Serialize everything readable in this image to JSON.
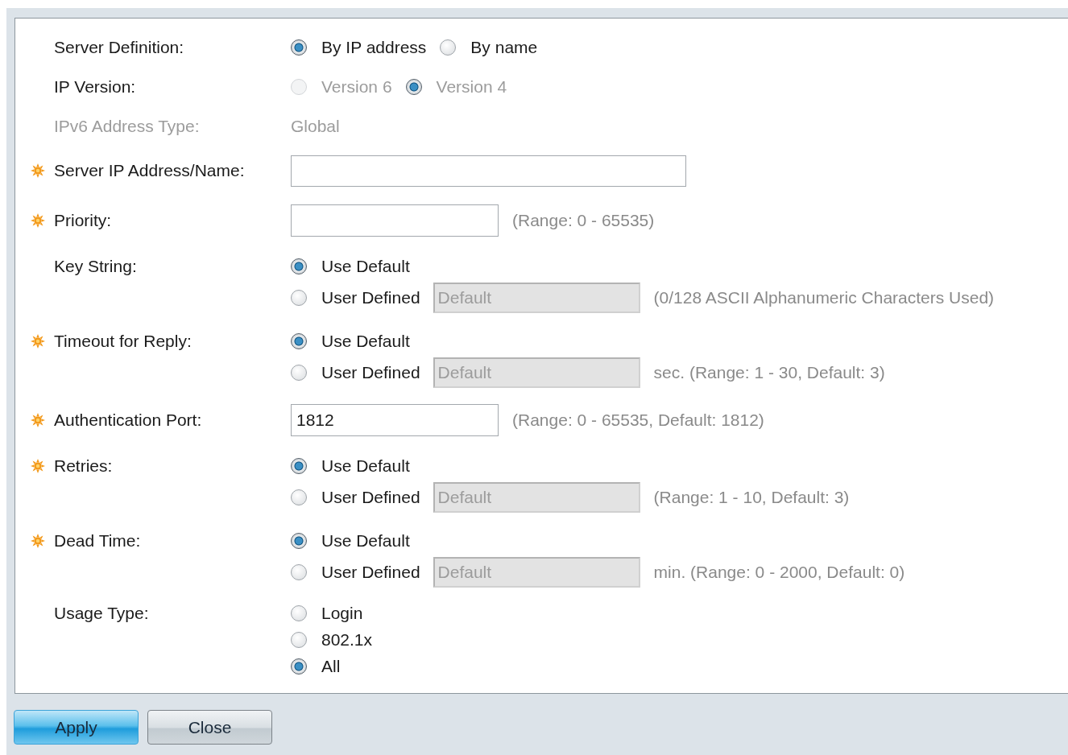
{
  "fields": [
    {
      "kind": "radio-inline",
      "label": "Server Definition:",
      "required": false,
      "disabled": false,
      "options": [
        {
          "label": "By IP address",
          "selected": true
        },
        {
          "label": "By name",
          "selected": false
        }
      ]
    },
    {
      "kind": "radio-inline",
      "label": "IP Version:",
      "required": false,
      "disabled": true,
      "options": [
        {
          "label": "Version 6",
          "selected": false
        },
        {
          "label": "Version 4",
          "selected": true
        }
      ]
    },
    {
      "kind": "static",
      "label": "IPv6 Address Type:",
      "required": false,
      "disabled": true,
      "value": "Global"
    },
    {
      "kind": "wide-text",
      "label": "Server IP Address/Name:",
      "required": true
    },
    {
      "kind": "text",
      "label": "Priority:",
      "required": true,
      "hint": "(Range: 0 - 65535)"
    },
    {
      "kind": "radio-stack",
      "label": "Key String:",
      "required": false,
      "options": [
        {
          "label": "Use Default",
          "selected": true
        },
        {
          "label": "User Defined",
          "selected": false,
          "input": {
            "value": "Default",
            "disabled": true
          },
          "hint": "(0/128 ASCII Alphanumeric Characters Used)"
        }
      ]
    },
    {
      "kind": "radio-stack",
      "label": "Timeout for Reply:",
      "required": true,
      "options": [
        {
          "label": "Use Default",
          "selected": true
        },
        {
          "label": "User Defined",
          "selected": false,
          "input": {
            "value": "Default",
            "disabled": true
          },
          "hint": "sec. (Range: 1 - 30, Default: 3)"
        }
      ]
    },
    {
      "kind": "text",
      "label": "Authentication Port:",
      "required": true,
      "value": "1812",
      "hint": "(Range: 0 - 65535, Default: 1812)"
    },
    {
      "kind": "radio-stack",
      "label": "Retries:",
      "required": true,
      "options": [
        {
          "label": "Use Default",
          "selected": true
        },
        {
          "label": "User Defined",
          "selected": false,
          "input": {
            "value": "Default",
            "disabled": true
          },
          "hint": "(Range: 1 - 10, Default: 3)"
        }
      ]
    },
    {
      "kind": "radio-stack",
      "label": "Dead Time:",
      "required": true,
      "options": [
        {
          "label": "Use Default",
          "selected": true
        },
        {
          "label": "User Defined",
          "selected": false,
          "input": {
            "value": "Default",
            "disabled": true
          },
          "hint": "min. (Range: 0 - 2000, Default: 0)"
        }
      ]
    },
    {
      "kind": "radio-list",
      "label": "Usage Type:",
      "required": false,
      "options": [
        {
          "label": "Login",
          "selected": false
        },
        {
          "label": "802.1x",
          "selected": false
        },
        {
          "label": "All",
          "selected": true
        }
      ]
    }
  ],
  "buttons": [
    {
      "label": "Apply",
      "kind": "primary"
    },
    {
      "label": "Close",
      "kind": "secondary"
    }
  ]
}
